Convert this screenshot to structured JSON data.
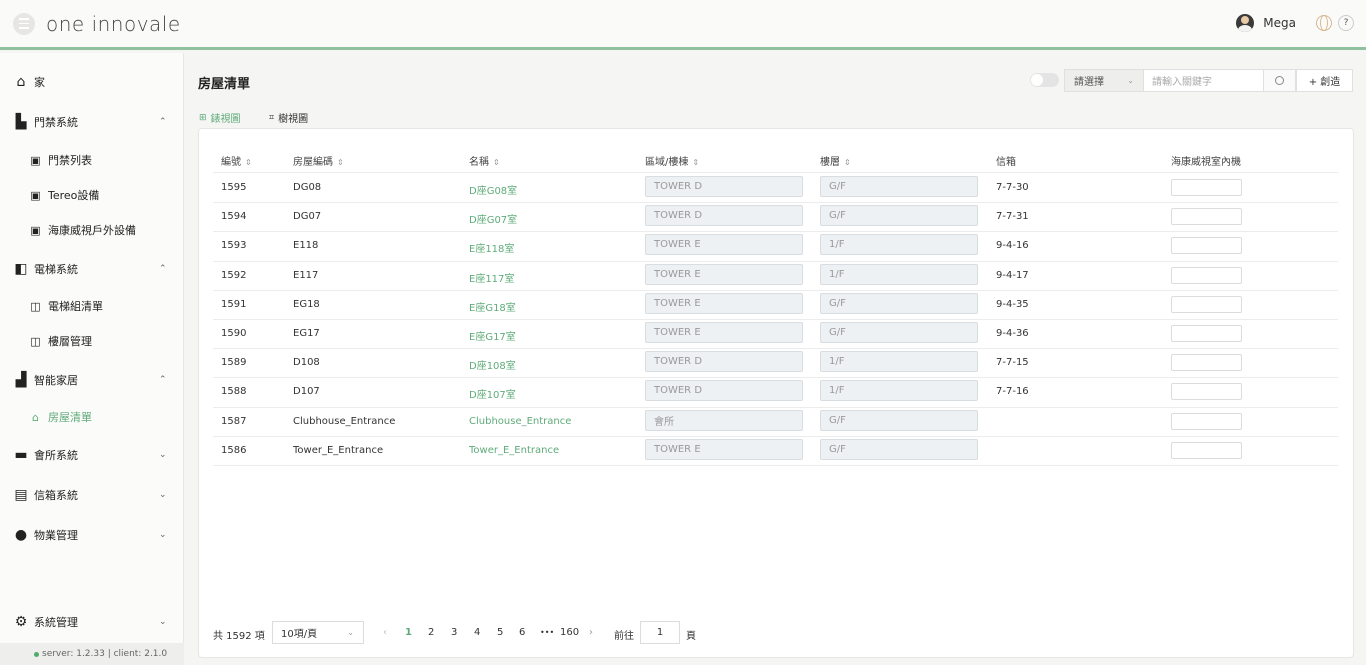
{
  "header": {
    "logo": "one innovale",
    "username": "Mega",
    "help": "?"
  },
  "sidebar": {
    "items": [
      {
        "label": "家"
      },
      {
        "label": "門禁系統",
        "chev": "⌃"
      },
      {
        "label": "門禁列表"
      },
      {
        "label": "Tereo設備"
      },
      {
        "label": "海康威視戶外設備"
      },
      {
        "label": "電梯系統",
        "chev": "⌃"
      },
      {
        "label": "電梯組清單"
      },
      {
        "label": "樓層管理"
      },
      {
        "label": "智能家居",
        "chev": "⌃"
      },
      {
        "label": "房屋清單"
      },
      {
        "label": "會所系統",
        "chev": "⌄"
      },
      {
        "label": "信箱系統",
        "chev": "⌄"
      },
      {
        "label": "物業管理",
        "chev": "⌄"
      },
      {
        "label": "系統管理",
        "chev": "⌄"
      }
    ],
    "version": "server: 1.2.33 | client: 2.1.0"
  },
  "main": {
    "title": "房屋清單",
    "select_placeholder": "請選擇",
    "search_placeholder": "請輸入關鍵字",
    "create_label": "+ 創造",
    "tabs": [
      {
        "label": "錶視圖"
      },
      {
        "label": "樹視圖"
      }
    ]
  },
  "table": {
    "headers": [
      "編號",
      "房屋編碼",
      "名稱",
      "區域/樓棟",
      "樓層",
      "信箱",
      "海康威視室內機"
    ],
    "rows": [
      {
        "id": "1595",
        "code": "DG08",
        "name": "D座G08室",
        "area": "TOWER D",
        "floor": "G/F",
        "mailbox": "7-7-30"
      },
      {
        "id": "1594",
        "code": "DG07",
        "name": "D座G07室",
        "area": "TOWER D",
        "floor": "G/F",
        "mailbox": "7-7-31"
      },
      {
        "id": "1593",
        "code": "E118",
        "name": "E座118室",
        "area": "TOWER E",
        "floor": "1/F",
        "mailbox": "9-4-16"
      },
      {
        "id": "1592",
        "code": "E117",
        "name": "E座117室",
        "area": "TOWER E",
        "floor": "1/F",
        "mailbox": "9-4-17"
      },
      {
        "id": "1591",
        "code": "EG18",
        "name": "E座G18室",
        "area": "TOWER E",
        "floor": "G/F",
        "mailbox": "9-4-35"
      },
      {
        "id": "1590",
        "code": "EG17",
        "name": "E座G17室",
        "area": "TOWER E",
        "floor": "G/F",
        "mailbox": "9-4-36"
      },
      {
        "id": "1589",
        "code": "D108",
        "name": "D座108室",
        "area": "TOWER D",
        "floor": "1/F",
        "mailbox": "7-7-15"
      },
      {
        "id": "1588",
        "code": "D107",
        "name": "D座107室",
        "area": "TOWER D",
        "floor": "1/F",
        "mailbox": "7-7-16"
      },
      {
        "id": "1587",
        "code": "Clubhouse_Entrance",
        "name": "Clubhouse_Entrance",
        "area": "會所",
        "floor": "G/F",
        "mailbox": ""
      },
      {
        "id": "1586",
        "code": "Tower_E_Entrance",
        "name": "Tower_E_Entrance",
        "area": "TOWER E",
        "floor": "G/F",
        "mailbox": ""
      }
    ]
  },
  "pagination": {
    "total": "共 1592 項",
    "page_size": "10項/頁",
    "prev": "‹",
    "pages": [
      "1",
      "2",
      "3",
      "4",
      "5",
      "6"
    ],
    "ellipsis": "•••",
    "last": "160",
    "next": "›",
    "goto_label": "前往",
    "goto_value": "1",
    "goto_suffix": "頁"
  },
  "colors": {
    "accent": "#5fab7a",
    "header_border": "#8fc1a0"
  }
}
